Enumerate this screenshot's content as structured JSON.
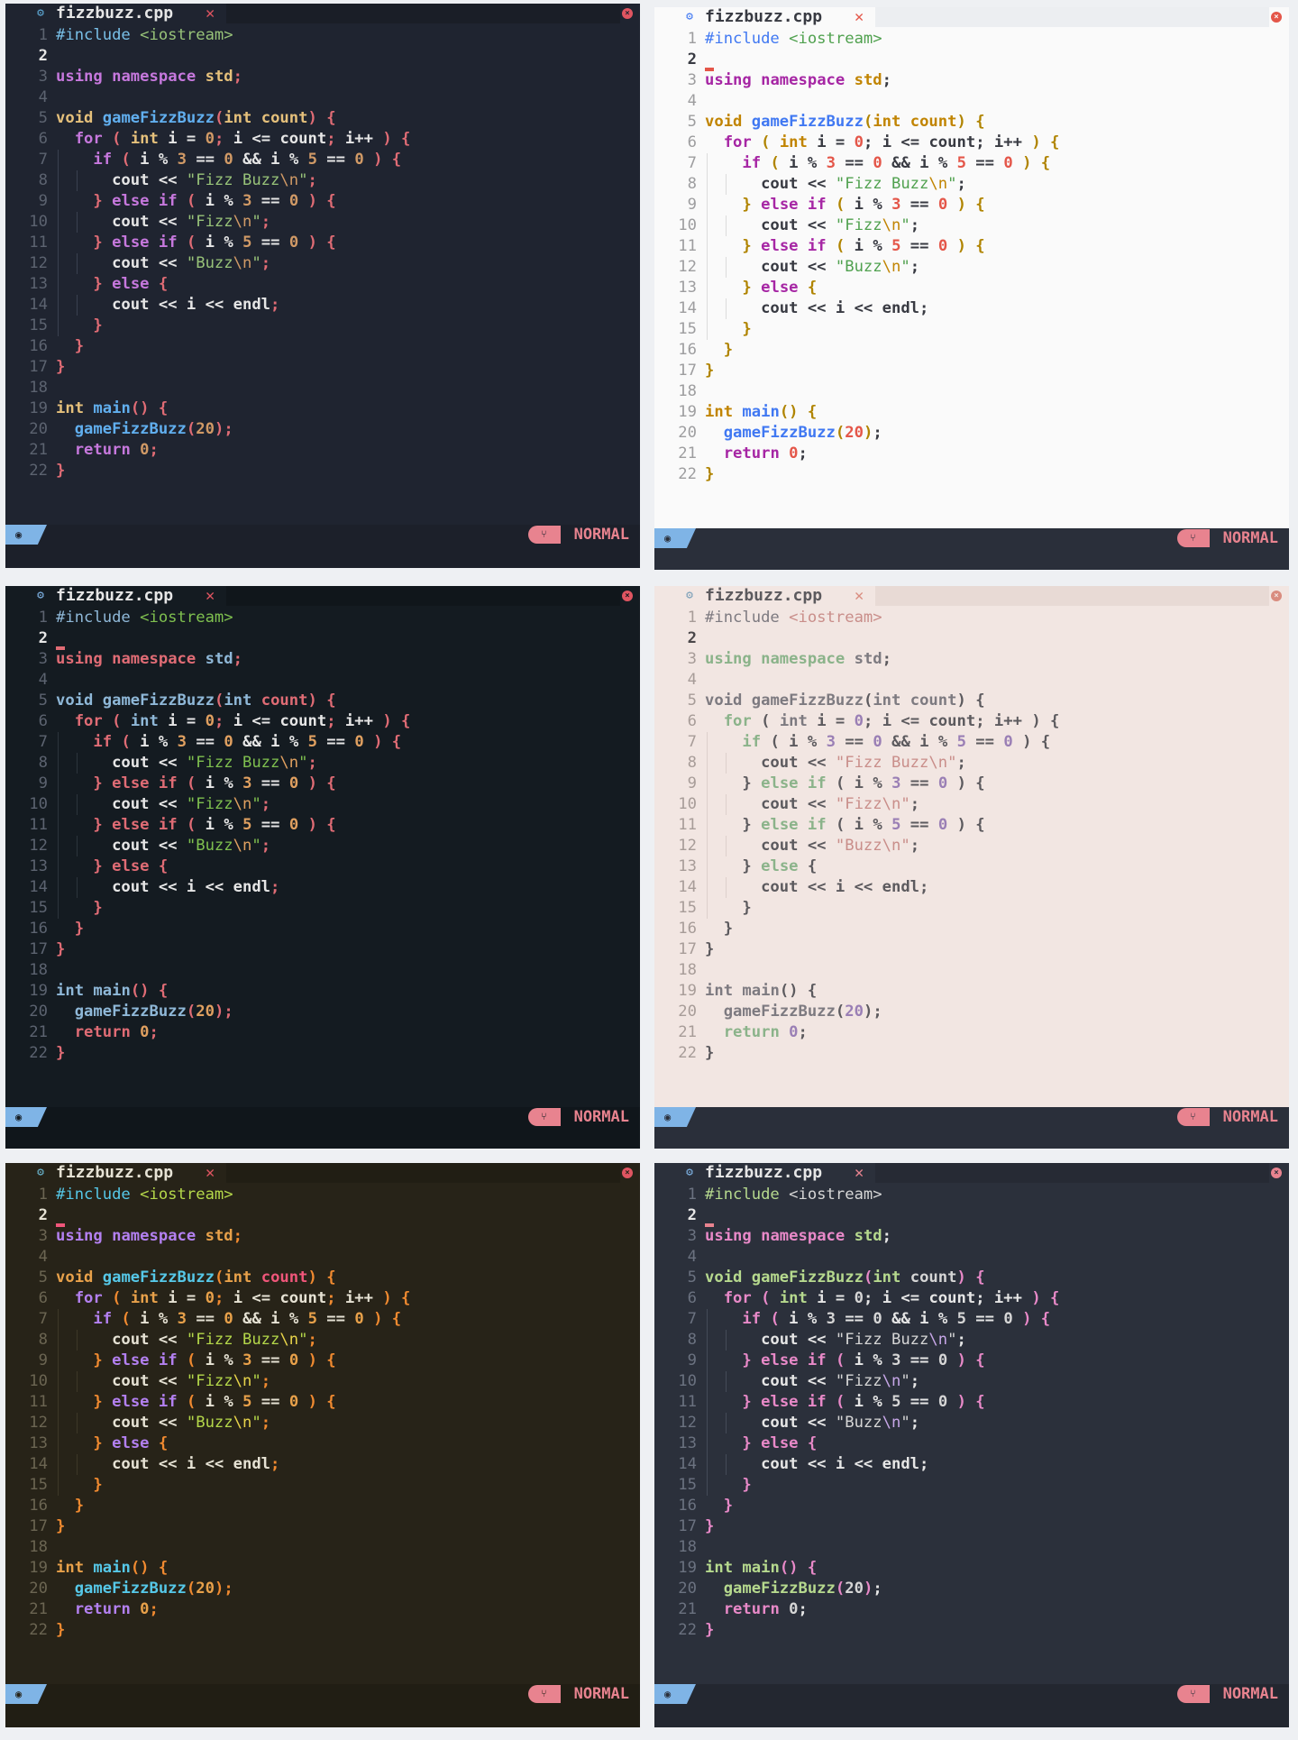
{
  "tab": {
    "filename": "fizzbuzz.cpp",
    "close_glyph": "✕",
    "file_icon": "gear-icon",
    "window_close_glyph": "×"
  },
  "status": {
    "mode": "NORMAL",
    "left_icon": "target-icon",
    "mode_icon": "git-branch-icon"
  },
  "code_lines": [
    [
      [
        "pp",
        "#include "
      ],
      [
        "str",
        "<iostream>"
      ]
    ],
    [],
    [
      [
        "kw",
        "using"
      ],
      [
        "p",
        " "
      ],
      [
        "kw",
        "namespace"
      ],
      [
        "p",
        " "
      ],
      [
        "ty",
        "std"
      ],
      [
        "pu",
        ";"
      ]
    ],
    [],
    [
      [
        "ty",
        "void"
      ],
      [
        "p",
        " "
      ],
      [
        "fn",
        "gameFizzBuzz"
      ],
      [
        "br",
        "("
      ],
      [
        "ty",
        "int"
      ],
      [
        "p",
        " "
      ],
      [
        "var",
        "count"
      ],
      [
        "br",
        ")"
      ],
      [
        "p",
        " "
      ],
      [
        "br",
        "{"
      ]
    ],
    [
      [
        "p",
        "  "
      ],
      [
        "kw",
        "for"
      ],
      [
        "p",
        " "
      ],
      [
        "br",
        "("
      ],
      [
        "p",
        " "
      ],
      [
        "ty",
        "int"
      ],
      [
        "p",
        " i "
      ],
      [
        "op",
        "="
      ],
      [
        "p",
        " "
      ],
      [
        "num",
        "0"
      ],
      [
        "pu",
        ";"
      ],
      [
        "p",
        " i "
      ],
      [
        "op",
        "<="
      ],
      [
        "p",
        " count"
      ],
      [
        "pu",
        ";"
      ],
      [
        "p",
        " i"
      ],
      [
        "op",
        "++"
      ],
      [
        "p",
        " "
      ],
      [
        "br",
        ")"
      ],
      [
        "p",
        " "
      ],
      [
        "br",
        "{"
      ]
    ],
    [
      [
        "p",
        "    "
      ],
      [
        "kw",
        "if"
      ],
      [
        "p",
        " "
      ],
      [
        "br",
        "("
      ],
      [
        "p",
        " i "
      ],
      [
        "op",
        "%"
      ],
      [
        "p",
        " "
      ],
      [
        "num",
        "3"
      ],
      [
        "p",
        " "
      ],
      [
        "op",
        "=="
      ],
      [
        "p",
        " "
      ],
      [
        "num",
        "0"
      ],
      [
        "p",
        " "
      ],
      [
        "op",
        "&&"
      ],
      [
        "p",
        " i "
      ],
      [
        "op",
        "%"
      ],
      [
        "p",
        " "
      ],
      [
        "num",
        "5"
      ],
      [
        "p",
        " "
      ],
      [
        "op",
        "=="
      ],
      [
        "p",
        " "
      ],
      [
        "num",
        "0"
      ],
      [
        "p",
        " "
      ],
      [
        "br",
        ")"
      ],
      [
        "p",
        " "
      ],
      [
        "br",
        "{"
      ]
    ],
    [
      [
        "p",
        "      cout "
      ],
      [
        "op",
        "<<"
      ],
      [
        "p",
        " "
      ],
      [
        "str",
        "\"Fizz Buzz"
      ],
      [
        "esc",
        "\\n"
      ],
      [
        "str",
        "\""
      ],
      [
        "pu",
        ";"
      ]
    ],
    [
      [
        "p",
        "    "
      ],
      [
        "br",
        "}"
      ],
      [
        "p",
        " "
      ],
      [
        "kw",
        "else"
      ],
      [
        "p",
        " "
      ],
      [
        "kw",
        "if"
      ],
      [
        "p",
        " "
      ],
      [
        "br",
        "("
      ],
      [
        "p",
        " i "
      ],
      [
        "op",
        "%"
      ],
      [
        "p",
        " "
      ],
      [
        "num",
        "3"
      ],
      [
        "p",
        " "
      ],
      [
        "op",
        "=="
      ],
      [
        "p",
        " "
      ],
      [
        "num",
        "0"
      ],
      [
        "p",
        " "
      ],
      [
        "br",
        ")"
      ],
      [
        "p",
        " "
      ],
      [
        "br",
        "{"
      ]
    ],
    [
      [
        "p",
        "      cout "
      ],
      [
        "op",
        "<<"
      ],
      [
        "p",
        " "
      ],
      [
        "str",
        "\"Fizz"
      ],
      [
        "esc",
        "\\n"
      ],
      [
        "str",
        "\""
      ],
      [
        "pu",
        ";"
      ]
    ],
    [
      [
        "p",
        "    "
      ],
      [
        "br",
        "}"
      ],
      [
        "p",
        " "
      ],
      [
        "kw",
        "else"
      ],
      [
        "p",
        " "
      ],
      [
        "kw",
        "if"
      ],
      [
        "p",
        " "
      ],
      [
        "br",
        "("
      ],
      [
        "p",
        " i "
      ],
      [
        "op",
        "%"
      ],
      [
        "p",
        " "
      ],
      [
        "num",
        "5"
      ],
      [
        "p",
        " "
      ],
      [
        "op",
        "=="
      ],
      [
        "p",
        " "
      ],
      [
        "num",
        "0"
      ],
      [
        "p",
        " "
      ],
      [
        "br",
        ")"
      ],
      [
        "p",
        " "
      ],
      [
        "br",
        "{"
      ]
    ],
    [
      [
        "p",
        "      cout "
      ],
      [
        "op",
        "<<"
      ],
      [
        "p",
        " "
      ],
      [
        "str",
        "\"Buzz"
      ],
      [
        "esc",
        "\\n"
      ],
      [
        "str",
        "\""
      ],
      [
        "pu",
        ";"
      ]
    ],
    [
      [
        "p",
        "    "
      ],
      [
        "br",
        "}"
      ],
      [
        "p",
        " "
      ],
      [
        "kw",
        "else"
      ],
      [
        "p",
        " "
      ],
      [
        "br",
        "{"
      ]
    ],
    [
      [
        "p",
        "      cout "
      ],
      [
        "op",
        "<<"
      ],
      [
        "p",
        " i "
      ],
      [
        "op",
        "<<"
      ],
      [
        "p",
        " endl"
      ],
      [
        "pu",
        ";"
      ]
    ],
    [
      [
        "p",
        "    "
      ],
      [
        "br",
        "}"
      ]
    ],
    [
      [
        "p",
        "  "
      ],
      [
        "br",
        "}"
      ]
    ],
    [
      [
        "br",
        "}"
      ]
    ],
    [],
    [
      [
        "ty",
        "int"
      ],
      [
        "p",
        " "
      ],
      [
        "fn",
        "main"
      ],
      [
        "br",
        "()"
      ],
      [
        "p",
        " "
      ],
      [
        "br",
        "{"
      ]
    ],
    [
      [
        "p",
        "  "
      ],
      [
        "fn",
        "gameFizzBuzz"
      ],
      [
        "br",
        "("
      ],
      [
        "num",
        "20"
      ],
      [
        "br",
        ")"
      ],
      [
        "pu",
        ";"
      ]
    ],
    [
      [
        "p",
        "  "
      ],
      [
        "kw",
        "return"
      ],
      [
        "p",
        " "
      ],
      [
        "num",
        "0"
      ],
      [
        "pu",
        ";"
      ]
    ],
    [
      [
        "br",
        "}"
      ]
    ]
  ],
  "line_numbers": [
    "1",
    "2",
    "3",
    "4",
    "5",
    "6",
    "7",
    "8",
    "9",
    "10",
    "11",
    "12",
    "13",
    "14",
    "15",
    "16",
    "17",
    "18",
    "19",
    "20",
    "21",
    "22"
  ],
  "current_line": 2,
  "panes": [
    {
      "id": "pane-1",
      "show_cursor": false,
      "colors": {
        "bg": "#1f2430",
        "tabbar": "#1f2430",
        "tabfill": "#1a1e27",
        "tab_text": "#e6e6e6",
        "tab_icon": "#5ea9d6",
        "tab_close": "#e05561",
        "win_close_bg": "#e05561",
        "win_close_fg": "#1f2430",
        "ln": "#5c6370",
        "ln_cur": "#e6e6e6",
        "guide": "#3a4150",
        "status_bg": "#1c202a",
        "status_left": "#7fb4e6",
        "status_left_fg": "#1f2430",
        "badge_bg": "#e8838f",
        "badge_fg": "#1f2430",
        "mode_fg": "#e8838f",
        "bottom": "#1c202a",
        "cursor": "#e06c75",
        "pp": "#79c0e8",
        "str": "#98c379",
        "esc": "#d19a66",
        "kw": "#c678dd",
        "ty": "#e5c07b",
        "fn": "#61afef",
        "var": "#e5c07b",
        "op": "#e6e6e6",
        "num": "#d19a66",
        "pu": "#e06c75",
        "br": "#e06c75",
        "p": "#e6e6e6"
      }
    },
    {
      "id": "pane-2",
      "show_cursor": true,
      "colors": {
        "bg": "#fafafa",
        "tabbar": "#fafafa",
        "tabfill": "#eceef1",
        "tab_text": "#383a42",
        "tab_icon": "#4078f2",
        "tab_close": "#e45649",
        "win_close_bg": "#e45649",
        "win_close_fg": "#fafafa",
        "ln": "#9d9d9f",
        "ln_cur": "#383a42",
        "guide": "#dcdcdc",
        "status_bg": "#2a2f3a",
        "status_left": "#7fb4e6",
        "status_left_fg": "#2a2f3a",
        "badge_bg": "#e8838f",
        "badge_fg": "#2a2f3a",
        "mode_fg": "#e8838f",
        "bottom": "#2a2f3a",
        "cursor": "#e45649",
        "pp": "#4078f2",
        "str": "#50a14f",
        "esc": "#c18401",
        "kw": "#a626a4",
        "ty": "#c18401",
        "fn": "#4078f2",
        "var": "#c18401",
        "op": "#383a42",
        "num": "#e45649",
        "pu": "#383a42",
        "br": "#b08400",
        "p": "#383a42"
      }
    },
    {
      "id": "pane-3",
      "show_cursor": true,
      "colors": {
        "bg": "#141b21",
        "tabbar": "#141b21",
        "tabfill": "#10161b",
        "tab_text": "#e6e6e6",
        "tab_icon": "#7fb4e6",
        "tab_close": "#e05561",
        "win_close_bg": "#e05561",
        "win_close_fg": "#141b21",
        "ln": "#5c6370",
        "ln_cur": "#e6e6e6",
        "guide": "#2c343c",
        "status_bg": "#10161b",
        "status_left": "#7fb4e6",
        "status_left_fg": "#141b21",
        "badge_bg": "#e8838f",
        "badge_fg": "#141b21",
        "mode_fg": "#e8838f",
        "bottom": "#10161b",
        "cursor": "#e06c75",
        "pp": "#8fb8d8",
        "str": "#7fc04f",
        "esc": "#e0a060",
        "kw": "#e06c75",
        "ty": "#8fb8d8",
        "fn": "#8fb8d8",
        "var": "#e06c75",
        "op": "#e6e6e6",
        "num": "#e0a060",
        "pu": "#e06c75",
        "br": "#e06c75",
        "p": "#e6e6e6"
      }
    },
    {
      "id": "pane-4",
      "show_cursor": false,
      "colors": {
        "bg": "#f2e6e2",
        "tabbar": "#f2e6e2",
        "tabfill": "#e8dad5",
        "tab_text": "#5c5a5e",
        "tab_icon": "#7a9fb8",
        "tab_close": "#d98c7f",
        "win_close_bg": "#d98c7f",
        "win_close_fg": "#f2e6e2",
        "ln": "#a79c98",
        "ln_cur": "#4a4749",
        "guide": "#ddd0cc",
        "status_bg": "#2a2f3a",
        "status_left": "#7fb4e6",
        "status_left_fg": "#2a2f3a",
        "badge_bg": "#e8838f",
        "badge_fg": "#2a2f3a",
        "mode_fg": "#e8838f",
        "bottom": "#2a2f3a",
        "cursor": "#e06c75",
        "pp": "#7d7a80",
        "str": "#c98e8a",
        "esc": "#c98e8a",
        "kw": "#8bb38a",
        "ty": "#7d7a80",
        "fn": "#7d7a80",
        "var": "#7d7a80",
        "op": "#5c5a5e",
        "num": "#9a7fb5",
        "pu": "#5c5a5e",
        "br": "#5c5a5e",
        "p": "#5c5a5e"
      }
    },
    {
      "id": "pane-5",
      "show_cursor": true,
      "colors": {
        "bg": "#272318",
        "tabbar": "#272318",
        "tabfill": "#211e14",
        "tab_text": "#e6e2d4",
        "tab_icon": "#6ab7d0",
        "tab_close": "#e05561",
        "win_close_bg": "#e05561",
        "win_close_fg": "#272318",
        "ln": "#6b6552",
        "ln_cur": "#e6e2d4",
        "guide": "#3d3828",
        "status_bg": "#211e14",
        "status_left": "#7fb4e6",
        "status_left_fg": "#272318",
        "badge_bg": "#e8838f",
        "badge_fg": "#272318",
        "mode_fg": "#e8838f",
        "bottom": "#211e14",
        "cursor": "#f0567a",
        "pp": "#56c8e8",
        "str": "#b5d84a",
        "esc": "#e8d44a",
        "kw": "#b380f0",
        "ty": "#e8a14a",
        "fn": "#56c8e8",
        "var": "#f0567a",
        "op": "#e6e2d4",
        "num": "#e8a14a",
        "pu": "#f08a30",
        "br": "#f08a30",
        "p": "#e6e2d4"
      }
    },
    {
      "id": "pane-6",
      "show_cursor": true,
      "colors": {
        "bg": "#2b303b",
        "tabbar": "#2b303b",
        "tabfill": "#262a34",
        "tab_text": "#e6e6e6",
        "tab_icon": "#7fb4e6",
        "tab_close": "#e8838f",
        "win_close_bg": "#e8838f",
        "win_close_fg": "#2b303b",
        "ln": "#6b7280",
        "ln_cur": "#e6e6e6",
        "guide": "#444b58",
        "status_bg": "#232730",
        "status_left": "#7fb4e6",
        "status_left_fg": "#2b303b",
        "badge_bg": "#e8838f",
        "badge_fg": "#2b303b",
        "mode_fg": "#e8838f",
        "bottom": "#232730",
        "cursor": "#e8838f",
        "pp": "#b6d98e",
        "str": "#d6d6d6",
        "esc": "#c7a7e8",
        "kw": "#e889c8",
        "ty": "#b6d98e",
        "fn": "#b6d98e",
        "var": "#d6d6d6",
        "op": "#e6e6e6",
        "num": "#d6d6d6",
        "pu": "#e6e6e6",
        "br": "#e889c8",
        "p": "#e6e6e6"
      }
    }
  ]
}
